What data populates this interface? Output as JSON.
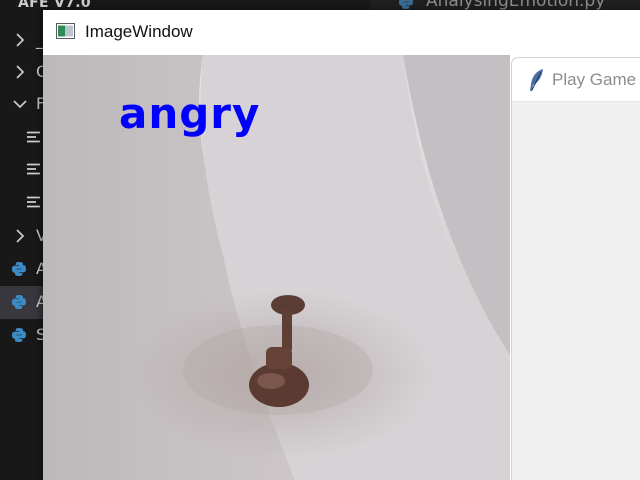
{
  "explorer": {
    "project_title": "AFE V7.0",
    "items": [
      {
        "type": "folder",
        "state": "collapsed",
        "label": "_"
      },
      {
        "type": "folder",
        "state": "collapsed",
        "label": "C"
      },
      {
        "type": "folder",
        "state": "expanded",
        "label": "F"
      },
      {
        "type": "file",
        "label": ""
      },
      {
        "type": "file",
        "label": ""
      },
      {
        "type": "file",
        "label": ""
      },
      {
        "type": "folder",
        "state": "collapsed",
        "label": "V"
      },
      {
        "type": "python",
        "label": "A"
      },
      {
        "type": "python",
        "label": "A",
        "selected": true
      },
      {
        "type": "python",
        "label": "S"
      }
    ]
  },
  "editor": {
    "active_tab": "AnalysingEmotion.py"
  },
  "image_window": {
    "title": "ImageWindow",
    "emotion_label": "angry",
    "label_color": "#0000ff"
  },
  "game_window": {
    "title": "Play Game"
  },
  "colors": {
    "vscode_bg": "#181818",
    "vscode_text": "#cccccc",
    "python_icon": "#3b8bc4",
    "selected_row": "#37373d",
    "tk_bg": "#f0f0f0"
  }
}
